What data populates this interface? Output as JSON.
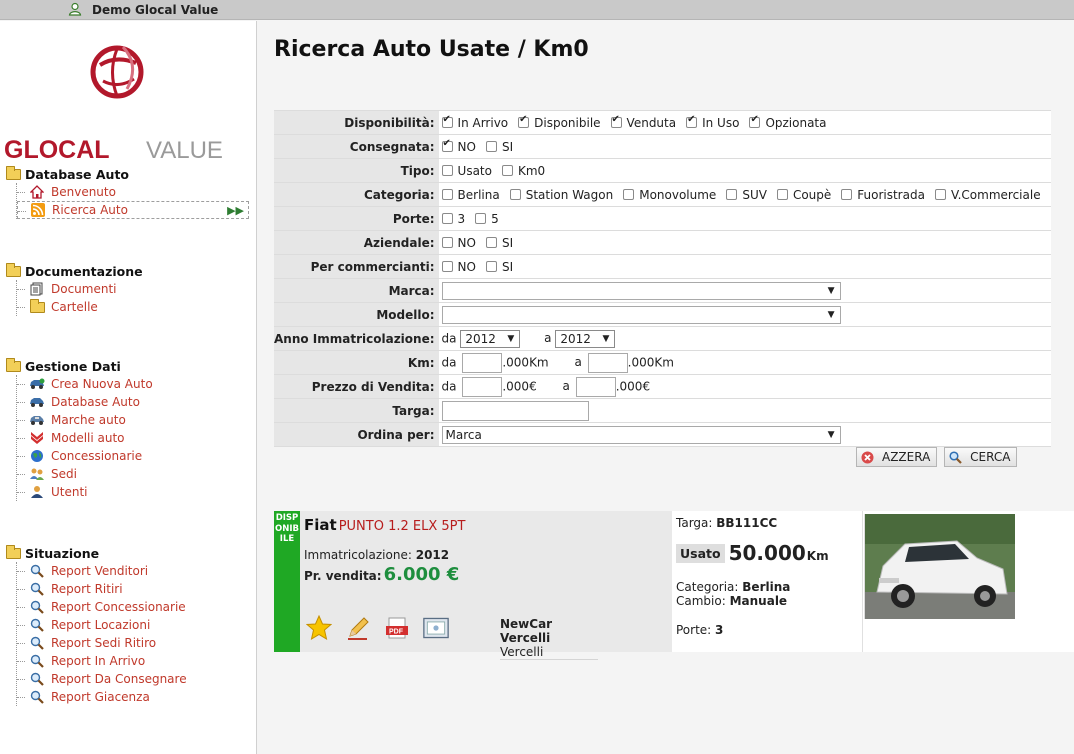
{
  "topbar": {
    "user_name": "Demo Glocal Value"
  },
  "logo": {
    "text_glocal": "GLOCAL",
    "text_value": "VALUE"
  },
  "sidebar": {
    "sections": [
      {
        "title": "Database Auto",
        "items": [
          {
            "label": "Benvenuto",
            "icon": "home-icon"
          },
          {
            "label": "Ricerca Auto",
            "icon": "rss-icon",
            "selected": true
          }
        ]
      },
      {
        "title": "Documentazione",
        "items": [
          {
            "label": "Documenti",
            "icon": "documents-icon"
          },
          {
            "label": "Cartelle",
            "icon": "folder-icon"
          }
        ]
      },
      {
        "title": "Gestione Dati",
        "items": [
          {
            "label": "Crea Nuova Auto",
            "icon": "car-add-icon"
          },
          {
            "label": "Database Auto",
            "icon": "car-icon"
          },
          {
            "label": "Marche auto",
            "icon": "car-brand-icon"
          },
          {
            "label": "Modelli auto",
            "icon": "chevrons-icon"
          },
          {
            "label": "Concessionarie",
            "icon": "globe-icon"
          },
          {
            "label": "Sedi",
            "icon": "people-icon"
          },
          {
            "label": "Utenti",
            "icon": "user-icon"
          }
        ]
      },
      {
        "title": "Situazione",
        "items": [
          {
            "label": "Report Venditori",
            "icon": "magnifier-icon"
          },
          {
            "label": "Report Ritiri",
            "icon": "magnifier-icon"
          },
          {
            "label": "Report Concessionarie",
            "icon": "magnifier-icon"
          },
          {
            "label": "Report Locazioni",
            "icon": "magnifier-icon"
          },
          {
            "label": "Report Sedi Ritiro",
            "icon": "magnifier-icon"
          },
          {
            "label": "Report In Arrivo",
            "icon": "magnifier-icon"
          },
          {
            "label": "Report Da Consegnare",
            "icon": "magnifier-icon"
          },
          {
            "label": "Report Giacenza",
            "icon": "magnifier-icon"
          }
        ]
      }
    ]
  },
  "page": {
    "title": "Ricerca Auto Usate / Km0"
  },
  "form": {
    "disponibilita": {
      "label": "Disponibilità:",
      "options": [
        {
          "label": "In Arrivo",
          "checked": true
        },
        {
          "label": "Disponibile",
          "checked": true
        },
        {
          "label": "Venduta",
          "checked": true
        },
        {
          "label": "In Uso",
          "checked": true
        },
        {
          "label": "Opzionata",
          "checked": true
        }
      ]
    },
    "consegnata": {
      "label": "Consegnata:",
      "options": [
        {
          "label": "NO",
          "checked": true
        },
        {
          "label": "SI",
          "checked": false
        }
      ]
    },
    "tipo": {
      "label": "Tipo:",
      "options": [
        {
          "label": "Usato",
          "checked": false
        },
        {
          "label": "Km0",
          "checked": false
        }
      ]
    },
    "categoria": {
      "label": "Categoria:",
      "options": [
        {
          "label": "Berlina",
          "checked": false
        },
        {
          "label": "Station Wagon",
          "checked": false
        },
        {
          "label": "Monovolume",
          "checked": false
        },
        {
          "label": "SUV",
          "checked": false
        },
        {
          "label": "Coupè",
          "checked": false
        },
        {
          "label": "Fuoristrada",
          "checked": false
        },
        {
          "label": "V.Commerciale",
          "checked": false
        }
      ]
    },
    "porte": {
      "label": "Porte:",
      "options": [
        {
          "label": "3",
          "checked": false
        },
        {
          "label": "5",
          "checked": false
        }
      ]
    },
    "aziendale": {
      "label": "Aziendale:",
      "options": [
        {
          "label": "NO",
          "checked": false
        },
        {
          "label": "SI",
          "checked": false
        }
      ]
    },
    "commercianti": {
      "label": "Per commercianti:",
      "options": [
        {
          "label": "NO",
          "checked": false
        },
        {
          "label": "SI",
          "checked": false
        }
      ]
    },
    "marca": {
      "label": "Marca:",
      "value": ""
    },
    "modello": {
      "label": "Modello:",
      "value": ""
    },
    "anno": {
      "label": "Anno Immatricolazione:",
      "da": "da",
      "a": "a",
      "from": "2012",
      "to": "2012"
    },
    "km": {
      "label": "Km:",
      "da": "da",
      "a": "a",
      "unit": ".000Km"
    },
    "prezzo": {
      "label": "Prezzo di Vendita:",
      "da": "da",
      "a": "a",
      "unit": ".000€"
    },
    "targa": {
      "label": "Targa:"
    },
    "ordina": {
      "label": "Ordina per:",
      "value": "Marca"
    },
    "azzera_label": "AZZERA",
    "cerca_label": "CERCA"
  },
  "result": {
    "status_text": "DISPONIBILE",
    "status_color": "#1fa824",
    "brand": "Fiat",
    "model": "PUNTO 1.2 ELX 5PT",
    "immat_label": "Immatricolazione:",
    "immat_value": "2012",
    "price_label": "Pr. vendita:",
    "price_value": "6.000 €",
    "dealer_name": "NewCar Vercelli",
    "dealer_city": "Vercelli",
    "targa_label": "Targa:",
    "targa_value": "BB111CC",
    "condition": "Usato",
    "km_value": "50.000",
    "km_unit": "Km",
    "categoria_label": "Categoria:",
    "categoria_value": "Berlina",
    "cambio_label": "Cambio:",
    "cambio_value": "Manuale",
    "porte_label": "Porte:",
    "porte_value": "3"
  }
}
